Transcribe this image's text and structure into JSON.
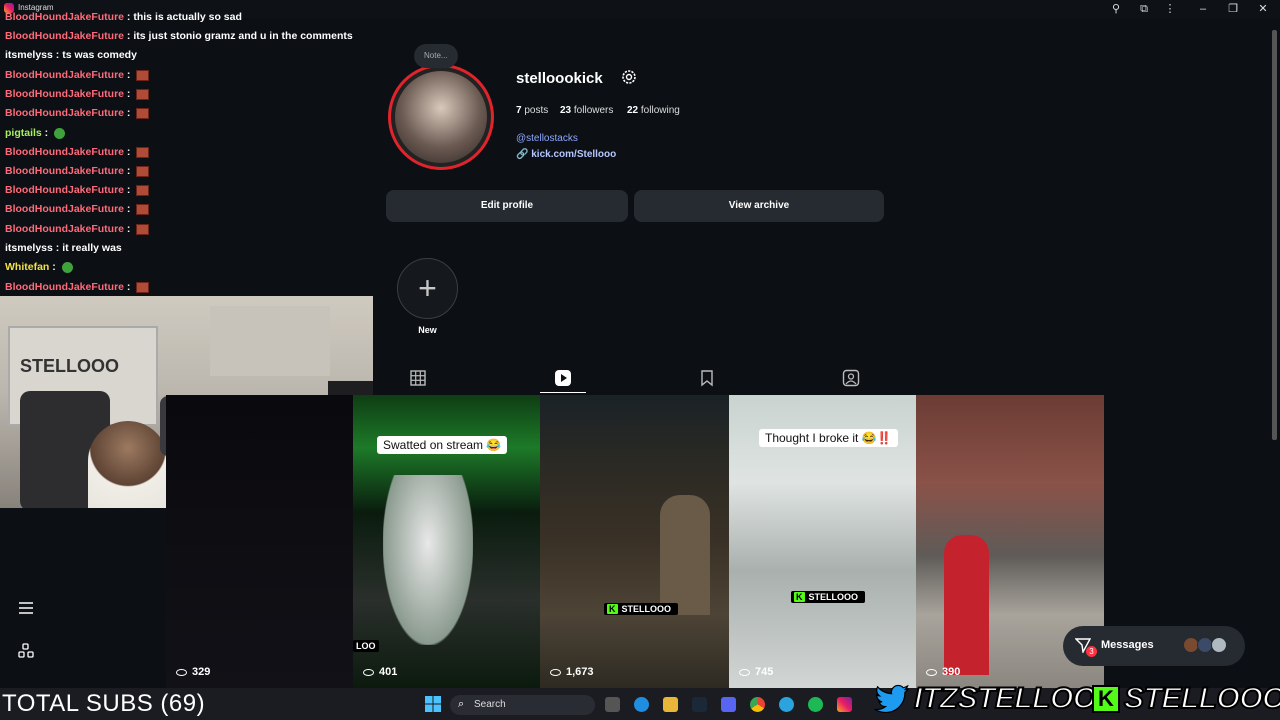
{
  "window": {
    "app_name": "Instagram",
    "controls": [
      "–",
      "❐",
      "✕"
    ]
  },
  "chat": {
    "messages": [
      {
        "user": "BloodHoundJakeFuture",
        "text": "this is actually so sad",
        "emote": ""
      },
      {
        "user": "BloodHoundJakeFuture",
        "text": "its just stonio gramz and u in the comments",
        "emote": ""
      },
      {
        "user": "itsmelyss",
        "text": "ts was comedy",
        "emote": ""
      },
      {
        "user": "BloodHoundJakeFuture",
        "text": "",
        "emote": "red"
      },
      {
        "user": "BloodHoundJakeFuture",
        "text": "",
        "emote": "red"
      },
      {
        "user": "BloodHoundJakeFuture",
        "text": "",
        "emote": "red"
      },
      {
        "user": "pigtails",
        "text": "",
        "emote": "green"
      },
      {
        "user": "BloodHoundJakeFuture",
        "text": "",
        "emote": "red"
      },
      {
        "user": "BloodHoundJakeFuture",
        "text": "",
        "emote": "red"
      },
      {
        "user": "BloodHoundJakeFuture",
        "text": "",
        "emote": "red"
      },
      {
        "user": "BloodHoundJakeFuture",
        "text": "",
        "emote": "red"
      },
      {
        "user": "BloodHoundJakeFuture",
        "text": "",
        "emote": "red"
      },
      {
        "user": "itsmelyss",
        "text": "it really was",
        "emote": ""
      },
      {
        "user": "Whitefan",
        "text": "",
        "emote": "green"
      },
      {
        "user": "BloodHoundJakeFuture",
        "text": "",
        "emote": "red"
      }
    ],
    "colors": {
      "pink": "#ff6a7a",
      "green": "#a8f060",
      "yellow": "#f2e24a"
    }
  },
  "profile": {
    "note": "Note...",
    "username": "stelloookick",
    "posts_count": "7",
    "posts_label": "posts",
    "followers_count": "23",
    "followers_label": "followers",
    "following_count": "22",
    "following_label": "following",
    "threads_handle": "@stellostacks",
    "link": "kick.com/Stellooo",
    "edit_label": "Edit profile",
    "archive_label": "View archive",
    "new_label": "New"
  },
  "reels": [
    {
      "views": "329",
      "caption": "",
      "kick": ""
    },
    {
      "views": "401",
      "caption": "Swatted on stream 😂",
      "kick": "LOO"
    },
    {
      "views": "1,673",
      "caption": "",
      "kick": "STELLOOO"
    },
    {
      "views": "745",
      "caption": "Thought I broke it 😂‼️",
      "kick": "STELLOOO"
    },
    {
      "views": "390",
      "caption": "",
      "kick": ""
    }
  ],
  "messages": {
    "label": "Messages",
    "badge": "3"
  },
  "overlay": {
    "subs": "TOTAL SUBS (69)",
    "twitter": "ITZSTELLOO",
    "kick": "STELLOOO"
  },
  "taskbar": {
    "search": "Search"
  },
  "colors": {
    "accent_red": "#e0242c",
    "kick_green": "#53fc18",
    "link_blue": "#8ea8ff",
    "twitter_blue": "#1d9bf0"
  }
}
